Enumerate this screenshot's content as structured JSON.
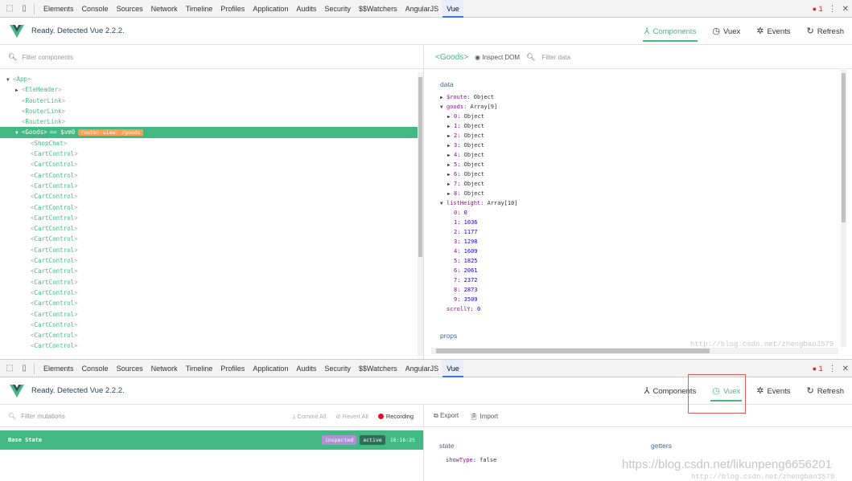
{
  "devtools": {
    "tabs": [
      "Elements",
      "Console",
      "Sources",
      "Network",
      "Timeline",
      "Profiles",
      "Application",
      "Audits",
      "Security",
      "$$Watchers",
      "AngularJS",
      "Vue"
    ],
    "active_tab": "Vue",
    "error_count": "1"
  },
  "vue": {
    "status": "Ready. Detected Vue 2.2.2.",
    "nav": [
      "Components",
      "Vuex",
      "Events",
      "Refresh"
    ]
  },
  "components": {
    "filter_placeholder": "Filter components",
    "tree": [
      {
        "name": "App",
        "depth": 0,
        "expanded": true,
        "arrow": "down"
      },
      {
        "name": "EleHeader",
        "depth": 1,
        "arrow": "right"
      },
      {
        "name": "RouterLink",
        "depth": 1,
        "arrow": ""
      },
      {
        "name": "RouterLink",
        "depth": 1,
        "arrow": ""
      },
      {
        "name": "RouterLink",
        "depth": 1,
        "arrow": ""
      },
      {
        "name": "Goods",
        "depth": 1,
        "arrow": "down",
        "selected": true,
        "ref": "== $vm0",
        "badge": "router-view: /goods"
      },
      {
        "name": "ShopChat",
        "depth": 2,
        "arrow": ""
      },
      {
        "name": "CartControl",
        "depth": 2,
        "arrow": ""
      },
      {
        "name": "CartControl",
        "depth": 2,
        "arrow": ""
      },
      {
        "name": "CartControl",
        "depth": 2,
        "arrow": ""
      },
      {
        "name": "CartControl",
        "depth": 2,
        "arrow": ""
      },
      {
        "name": "CartControl",
        "depth": 2,
        "arrow": ""
      },
      {
        "name": "CartControl",
        "depth": 2,
        "arrow": ""
      },
      {
        "name": "CartControl",
        "depth": 2,
        "arrow": ""
      },
      {
        "name": "CartControl",
        "depth": 2,
        "arrow": ""
      },
      {
        "name": "CartControl",
        "depth": 2,
        "arrow": ""
      },
      {
        "name": "CartControl",
        "depth": 2,
        "arrow": ""
      },
      {
        "name": "CartControl",
        "depth": 2,
        "arrow": ""
      },
      {
        "name": "CartControl",
        "depth": 2,
        "arrow": ""
      },
      {
        "name": "CartControl",
        "depth": 2,
        "arrow": ""
      },
      {
        "name": "CartControl",
        "depth": 2,
        "arrow": ""
      },
      {
        "name": "CartControl",
        "depth": 2,
        "arrow": ""
      },
      {
        "name": "CartControl",
        "depth": 2,
        "arrow": ""
      },
      {
        "name": "CartControl",
        "depth": 2,
        "arrow": ""
      },
      {
        "name": "CartControl",
        "depth": 2,
        "arrow": ""
      },
      {
        "name": "CartControl",
        "depth": 2,
        "arrow": ""
      }
    ]
  },
  "inspector": {
    "title": "Goods",
    "inspect_dom": "Inspect DOM",
    "filter_placeholder": "Filter data",
    "data_title": "data",
    "props_title": "props",
    "rows": [
      {
        "indent": 0,
        "arrow": "right",
        "key": "$route",
        "sep": ": ",
        "val": "Object",
        "kind": "type"
      },
      {
        "indent": 0,
        "arrow": "down",
        "key": "goods",
        "sep": ": ",
        "val": "Array[9]",
        "kind": "type"
      },
      {
        "indent": 1,
        "arrow": "right",
        "key": "0",
        "sep": ": ",
        "val": "Object",
        "kind": "type"
      },
      {
        "indent": 1,
        "arrow": "right",
        "key": "1",
        "sep": ": ",
        "val": "Object",
        "kind": "type"
      },
      {
        "indent": 1,
        "arrow": "right",
        "key": "2",
        "sep": ": ",
        "val": "Object",
        "kind": "type"
      },
      {
        "indent": 1,
        "arrow": "right",
        "key": "3",
        "sep": ": ",
        "val": "Object",
        "kind": "type"
      },
      {
        "indent": 1,
        "arrow": "right",
        "key": "4",
        "sep": ": ",
        "val": "Object",
        "kind": "type"
      },
      {
        "indent": 1,
        "arrow": "right",
        "key": "5",
        "sep": ": ",
        "val": "Object",
        "kind": "type"
      },
      {
        "indent": 1,
        "arrow": "right",
        "key": "6",
        "sep": ": ",
        "val": "Object",
        "kind": "type"
      },
      {
        "indent": 1,
        "arrow": "right",
        "key": "7",
        "sep": ": ",
        "val": "Object",
        "kind": "type"
      },
      {
        "indent": 1,
        "arrow": "right",
        "key": "8",
        "sep": ": ",
        "val": "Object",
        "kind": "type"
      },
      {
        "indent": 0,
        "arrow": "down",
        "key": "listHeight",
        "sep": ": ",
        "val": "Array[10]",
        "kind": "type"
      },
      {
        "indent": 1,
        "arrow": "",
        "key": "0",
        "sep": ": ",
        "val": "0",
        "kind": "num"
      },
      {
        "indent": 1,
        "arrow": "",
        "key": "1",
        "sep": ": ",
        "val": "1036",
        "kind": "num"
      },
      {
        "indent": 1,
        "arrow": "",
        "key": "2",
        "sep": ": ",
        "val": "1177",
        "kind": "num"
      },
      {
        "indent": 1,
        "arrow": "",
        "key": "3",
        "sep": ": ",
        "val": "1298",
        "kind": "num"
      },
      {
        "indent": 1,
        "arrow": "",
        "key": "4",
        "sep": ": ",
        "val": "1609",
        "kind": "num"
      },
      {
        "indent": 1,
        "arrow": "",
        "key": "5",
        "sep": ": ",
        "val": "1825",
        "kind": "num"
      },
      {
        "indent": 1,
        "arrow": "",
        "key": "6",
        "sep": ": ",
        "val": "2061",
        "kind": "num"
      },
      {
        "indent": 1,
        "arrow": "",
        "key": "7",
        "sep": ": ",
        "val": "2372",
        "kind": "num"
      },
      {
        "indent": 1,
        "arrow": "",
        "key": "8",
        "sep": ": ",
        "val": "2873",
        "kind": "num"
      },
      {
        "indent": 1,
        "arrow": "",
        "key": "9",
        "sep": ": ",
        "val": "3509",
        "kind": "num"
      },
      {
        "indent": 0,
        "arrow": "",
        "key": "scrollY",
        "sep": ": ",
        "val": "0",
        "kind": "num"
      }
    ]
  },
  "vuex": {
    "filter_placeholder": "Filter mutations",
    "commit_all": "Commit All",
    "revert_all": "Revert All",
    "recording": "Recording",
    "export": "Export",
    "import": "Import",
    "base_state": "Base State",
    "tag_inspected": "inspected",
    "tag_active": "active",
    "time": "16:16:25",
    "state_title": "state",
    "getters_title": "getters",
    "state_key": "showType",
    "state_val": "false"
  },
  "watermarks": {
    "top": "http://blog.csdn.net/zhengbao3579",
    "bottom1": "https://blog.csdn.net/likunpeng6656201",
    "bottom2": "http://blog.csdn.net/zhengbao3579"
  }
}
